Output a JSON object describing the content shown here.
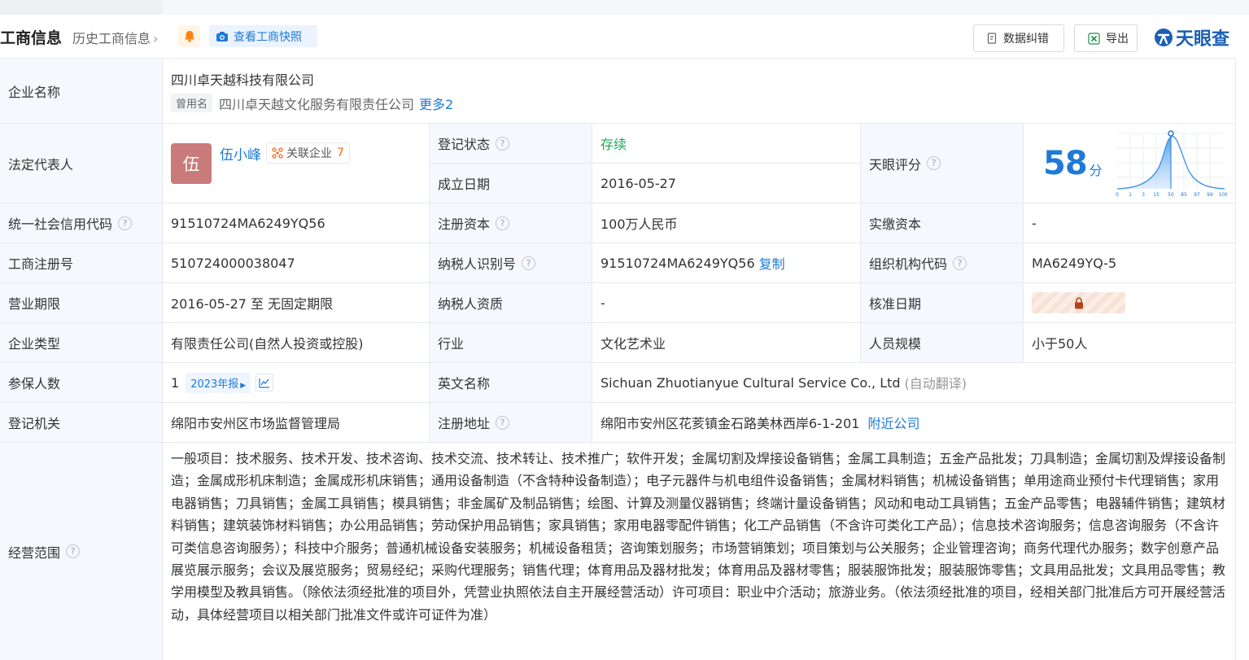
{
  "header": {
    "title": "工商信息",
    "history_label": "历史工商信息",
    "snapshot_label": "查看工商快照",
    "data_fix_label": "数据纠错",
    "export_label": "导出",
    "logo_text": "天眼查"
  },
  "info": {
    "company_name_label": "企业名称",
    "company_name": "四川卓天越科技有限公司",
    "alias_tag": "曾用名",
    "alias_name": "四川卓天越文化服务有限责任公司",
    "alias_more": "更多2",
    "legal_rep_label": "法定代表人",
    "legal_rep_avatar": "伍",
    "legal_rep_name": "伍小峰",
    "related_label": "关联企业",
    "related_count": "7",
    "reg_status_label": "登记状态",
    "reg_status": "存续",
    "found_date_label": "成立日期",
    "found_date": "2016-05-27",
    "score_label": "天眼评分",
    "score": "58",
    "score_unit": "分",
    "score_ticks": [
      "0",
      "1",
      "3",
      "15",
      "50",
      "85",
      "97",
      "99",
      "100"
    ],
    "credit_code_label": "统一社会信用代码",
    "credit_code": "91510724MA6249YQ56",
    "reg_capital_label": "注册资本",
    "reg_capital": "100万人民币",
    "paid_capital_label": "实缴资本",
    "paid_capital": "-",
    "biz_reg_no_label": "工商注册号",
    "biz_reg_no": "510724000038047",
    "taxpayer_id_label": "纳税人识别号",
    "taxpayer_id": "91510724MA6249YQ56",
    "copy_label": "复制",
    "org_code_label": "组织机构代码",
    "org_code": "MA6249YQ-5",
    "term_label": "营业期限",
    "term": "2016-05-27 至 无固定期限",
    "taxpayer_qual_label": "纳税人资质",
    "taxpayer_qual": "-",
    "approve_date_label": "核准日期",
    "type_label": "企业类型",
    "type": "有限责任公司(自然人投资或控股)",
    "industry_label": "行业",
    "industry": "文化艺术业",
    "staff_label": "人员规模",
    "staff": "小于50人",
    "insured_label": "参保人数",
    "insured": "1",
    "insured_year": "2023年报",
    "en_name_label": "英文名称",
    "en_name": "Sichuan Zhuotianyue Cultural Service Co., Ltd",
    "en_name_note": "(自动翻译)",
    "authority_label": "登记机关",
    "authority": "绵阳市安州区市场监督管理局",
    "address_label": "注册地址",
    "address": "绵阳市安州区花荄镇金石路美林西岸6-1-201",
    "nearby_label": "附近公司",
    "scope_label": "经营范围",
    "scope": "一般项目：技术服务、技术开发、技术咨询、技术交流、技术转让、技术推广；软件开发；金属切割及焊接设备销售；金属工具制造；五金产品批发；刀具制造；金属切割及焊接设备制造；金属成形机床制造；金属成形机床销售；通用设备制造（不含特种设备制造）；电子元器件与机电组件设备销售；金属材料销售；机械设备销售；单用途商业预付卡代理销售；家用电器销售；刀具销售；金属工具销售；模具销售；非金属矿及制品销售；绘图、计算及测量仪器销售；终端计量设备销售；风动和电动工具销售；五金产品零售；电器辅件销售；建筑材料销售；建筑装饰材料销售；办公用品销售；劳动保护用品销售；家具销售；家用电器零配件销售；化工产品销售（不含许可类化工产品）；信息技术咨询服务；信息咨询服务（不含许可类信息咨询服务）；科技中介服务；普通机械设备安装服务；机械设备租赁；咨询策划服务；市场营销策划；项目策划与公关服务；企业管理咨询；商务代理代办服务；数字创意产品展览展示服务；会议及展览服务；贸易经纪；采购代理服务；销售代理；体育用品及器材批发；体育用品及器材零售；服装服饰批发；服装服饰零售；文具用品批发；文具用品零售；教学用模型及教具销售。（除依法须经批准的项目外，凭营业执照依法自主开展经营活动）许可项目：职业中介活动；旅游业务。（依法须经批准的项目，经相关部门批准后方可开展经营活动，具体经营项目以相关部门批准文件或许可证件为准）"
  },
  "colors": {
    "accent": "#1f7ad6",
    "label_bg": "#f5f8fc",
    "border": "#e6eaf0",
    "status_green": "#23a35a",
    "avatar_bg": "#c97a7a"
  }
}
